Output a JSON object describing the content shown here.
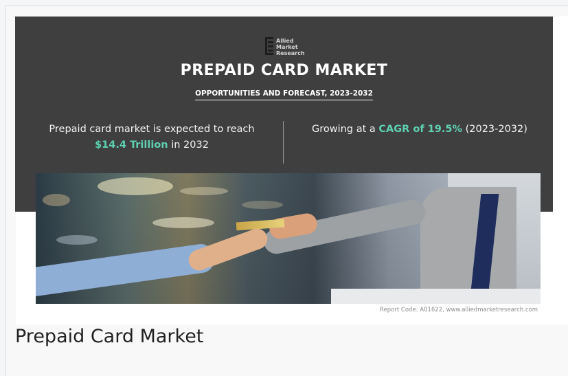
{
  "logo": {
    "line1": "Allied",
    "line2": "Market",
    "line3": "Research"
  },
  "banner": {
    "title": "PREPAID CARD MARKET",
    "subtitle": "OPPORTUNITIES AND FORECAST, 2023-2032",
    "left_text_1": "Prepaid card market is expected to reach",
    "left_highlight": "$14.4 Trillion",
    "left_text_2": "in 2032",
    "right_text_1": "Growing at a",
    "right_highlight": "CAGR of 19.5%",
    "right_text_2": "(2023-2032)"
  },
  "report_code": "Report Code: A01622, www.alliedmarketresearch.com",
  "caption": "Prepaid Card Market",
  "colors": {
    "banner_bg": "#3f3f40",
    "highlight": "#5ed1b1"
  }
}
